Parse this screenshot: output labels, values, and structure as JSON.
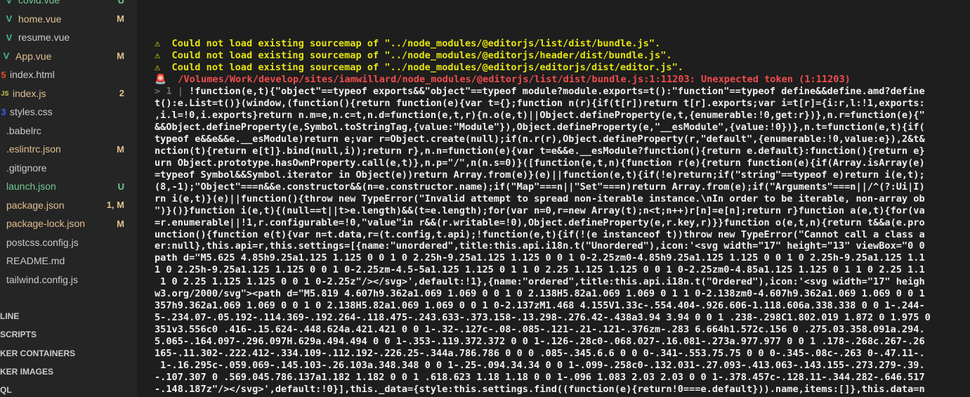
{
  "sidebar": {
    "files": [
      {
        "name": "covid.vue",
        "icon": "V",
        "icon_color": "#42b883",
        "name_color": "#73c991",
        "status": "U",
        "status_color": "#73c991"
      },
      {
        "name": "home.vue",
        "icon": "V",
        "icon_color": "#42b883",
        "name_color": "#e2c08d",
        "status": "M",
        "status_color": "#e2c08d"
      },
      {
        "name": "resume.vue",
        "icon": "V",
        "icon_color": "#42b883",
        "name_color": "#cccccc",
        "status": "",
        "status_color": "#cccccc"
      },
      {
        "name": "App.vue",
        "icon": "V",
        "icon_color": "#42b883",
        "name_color": "#e2c08d",
        "status": "M",
        "status_color": "#e2c08d"
      },
      {
        "name": "index.html",
        "icon": "5",
        "icon_color": "#e44d26",
        "name_color": "#cccccc",
        "status": "",
        "status_color": "#cccccc"
      },
      {
        "name": "index.js",
        "icon": "JS",
        "icon_color": "#cbcb41",
        "name_color": "#e2c08d",
        "status": "2",
        "status_color": "#e2c08d"
      },
      {
        "name": "styles.css",
        "icon": "3",
        "icon_color": "#2965f1",
        "name_color": "#cccccc",
        "status": "",
        "status_color": "#cccccc"
      },
      {
        "name": ".babelrc",
        "icon": "",
        "icon_color": "#cccccc",
        "name_color": "#cccccc",
        "status": "",
        "status_color": "#cccccc"
      },
      {
        "name": ".eslintrc.json",
        "icon": "",
        "icon_color": "#cccccc",
        "name_color": "#e2c08d",
        "status": "M",
        "status_color": "#e2c08d"
      },
      {
        "name": ".gitignore",
        "icon": "",
        "icon_color": "#cccccc",
        "name_color": "#cccccc",
        "status": "",
        "status_color": "#cccccc"
      },
      {
        "name": "launch.json",
        "icon": "",
        "icon_color": "#cccccc",
        "name_color": "#73c991",
        "status": "U",
        "status_color": "#73c991"
      },
      {
        "name": "package.json",
        "icon": "",
        "icon_color": "#cccccc",
        "name_color": "#e2c08d",
        "status": "1, M",
        "status_color": "#e2c08d"
      },
      {
        "name": "package-lock.json",
        "icon": "",
        "icon_color": "#cccccc",
        "name_color": "#e2c08d",
        "status": "M",
        "status_color": "#e2c08d"
      },
      {
        "name": "postcss.config.js",
        "icon": "",
        "icon_color": "#cccccc",
        "name_color": "#cccccc",
        "status": "",
        "status_color": "#cccccc"
      },
      {
        "name": "README.md",
        "icon": "",
        "icon_color": "#cccccc",
        "name_color": "#cccccc",
        "status": "",
        "status_color": "#cccccc"
      },
      {
        "name": "tailwind.config.js",
        "icon": "",
        "icon_color": "#cccccc",
        "name_color": "#cccccc",
        "status": "",
        "status_color": "#cccccc"
      }
    ],
    "sections": [
      {
        "label": "LINE"
      },
      {
        "label": "SCRIPTS"
      },
      {
        "label": "KER CONTAINERS"
      },
      {
        "label": "KER IMAGES"
      },
      {
        "label": "QL"
      }
    ]
  },
  "terminal": {
    "warnings": [
      "⚠  Could not load existing sourcemap of \"../node_modules/@editorjs/list/dist/bundle.js\".",
      "⚠  Could not load existing sourcemap of \"../node_modules/@editorjs/header/dist/bundle.js\".",
      "⚠  Could not load existing sourcemap of \"../node_modules/@editorjs/editorjs/dist/editor.js\"."
    ],
    "error": "🚨  /Volumes/Work/develop/sites/iamwillard/node_modules/@editorjs/list/dist/bundle.js:1:11203: Unexpected token (1:11203)",
    "code_prefix": "> 1 | ",
    "code_lines": [
      "!function(e,t){\"object\"==typeof exports&&\"object\"==typeof module?module.exports=t():\"function\"==typeof define&&define.amd?define",
      "t():e.List=t()}(window,(function(){return function(e){var t={};function n(r){if(t[r])return t[r].exports;var i=t[r]={i:r,l:!1,exports:",
      ",i.l=!0,i.exports}return n.m=e,n.c=t,n.d=function(e,t,r){n.o(e,t)||Object.defineProperty(e,t,{enumerable:!0,get:r})},n.r=function(e){\"",
      "&&Object.defineProperty(e,Symbol.toStringTag,{value:\"Module\"}),Object.defineProperty(e,\"__esModule\",{value:!0})},n.t=function(e,t){if(",
      "typeof e&&e&&e.__esModule)return e;var r=Object.create(null);if(n.r(r),Object.defineProperty(r,\"default\",{enumerable:!0,value:e}),2&t&",
      "nction(t){return e[t]}.bind(null,i));return r},n.n=function(e){var t=e&&e.__esModule?function(){return e.default}:function(){return e}",
      "urn Object.prototype.hasOwnProperty.call(e,t)},n.p=\"/\",n(n.s=0)}([function(e,t,n){function r(e){return function(e){if(Array.isArray(e)",
      "=typeof Symbol&&Symbol.iterator in Object(e))return Array.from(e)}(e)||function(e,t){if(!e)return;if(\"string\"==typeof e)return i(e,t);",
      "(8,-1);\"Object\"===n&&e.constructor&&(n=e.constructor.name);if(\"Map\"===n||\"Set\"===n)return Array.from(e);if(\"Arguments\"===n||/^(?:Ui|I)",
      "rn i(e,t)}(e)||function(){throw new TypeError(\"Invalid attempt to spread non-iterable instance.\\nIn order to be iterable, non-array ob",
      "\")}()}function i(e,t){(null==t||t>e.length)&&(t=e.length);for(var n=0,r=new Array(t);n<t;n++)r[n]=e[n];return r}function a(e,t){for(va",
      "=r.enumerable||!1,r.configurable=!0,\"value\"in r&&(r.writable=!0),Object.defineProperty(e,r.key,r)}}function o(e,t,n){return t&&a(e.pro",
      "unction(){function e(t){var n=t.data,r=(t.config,t.api);!function(e,t){if(!(e instanceof t))throw new TypeError(\"Cannot call a class a",
      "er:null},this.api=r,this.settings=[{name:\"unordered\",title:this.api.i18n.t(\"Unordered\"),icon:'<svg width=\"17\" height=\"13\" viewBox=\"0 0",
      "path d=\"M5.625 4.85h9.25a1.125 1.125 0 0 1 0 2.25h-9.25a1.125 1.125 0 0 1 0-2.25zm0-4.85h9.25a1.125 1.125 0 0 1 0 2.25h-9.25a1.125 1.1",
      "1 0 2.25h-9.25a1.125 1.125 0 0 1 0-2.25zm-4.5-5a1.125 1.125 0 1 1 0 2.25 1.125 1.125 0 0 1 0-2.25zm0-4.85a1.125 1.125 0 1 1 0 2.25 1.1",
      " 1 0 2.25 1.125 1.125 0 0 1 0-2.25z\"/></svg>',default:!1},{name:\"ordered\",title:this.api.i18n.t(\"Ordered\"),icon:'<svg width=\"17\" heigh",
      "w3.org/2000/svg\"><path d=\"M5.819 4.607h9.362a1.069 1.069 0 0 1 0 2.138H5.82a1.069 1.069 0 1 1 0-2.138zm0-4.607h9.362a1.069 1.069 0 0 1",
      "357h9.362a1.069 1.069 0 0 1 0 2.138H5.82a1.069 1.069 0 0 1 0-2.137zM1.468 4.155V1.33c-.554.404-.926.606-1.118.606a.338.338 0 0 1-.244-",
      "5-.234.07-.05.192-.114.369-.192.264-.118.475-.243.633-.373.158-.13.298-.276.42-.438a3.94 3.94 0 0 1 .238-.298C1.802.019 1.872 0 1.975 0",
      "351v3.556c0 .416-.15.624-.448.624a.421.421 0 0 1-.32-.127c-.08-.085-.121-.21-.121-.376zm-.283 6.664h1.572c.156 0 .275.03.358.091a.294.",
      "5.065-.164.097-.296.097H.629a.494.494 0 0 1-.353-.119.372.372 0 0 1-.126-.28c0-.068.027-.16.081-.273a.977.977 0 0 1 .178-.268c.267-.26",
      "165-.11.302-.222.412-.334.109-.112.192-.226.25-.344a.786.786 0 0 0 .085-.345.6.6 0 0 0-.341-.553.75.75 0 0 0-.345-.08c-.263 0-.47.11-.",
      " 1-.16.295c-.059.069-.145.103-.26.103a.348.348 0 0 1-.25-.094.34.34 0 0 1-.099-.258c0-.132.031-.27.093-.413.063-.143.155-.273.279-.39.",
      "-.107.307 0 .569.045.786.137a1.182 1.182 0 0 1 .618.623 1.18 1.18 0 0 1-.096 1.083 2.03 2.03 0 0 1-.378.457c-.128.11-.344.282-.646.517",
      "-.148.187z\"/></svg>',default:!0}],this._data={style:this.settings.find((function(e){return!0===e.default})).name,items:[]},this.data=n"
    ]
  },
  "colors": {
    "sidebar_bg": "#252526",
    "terminal_bg": "#1e1e1e",
    "warning": "#e5e510",
    "error": "#f14c4c",
    "code": "#f1f1f1"
  }
}
